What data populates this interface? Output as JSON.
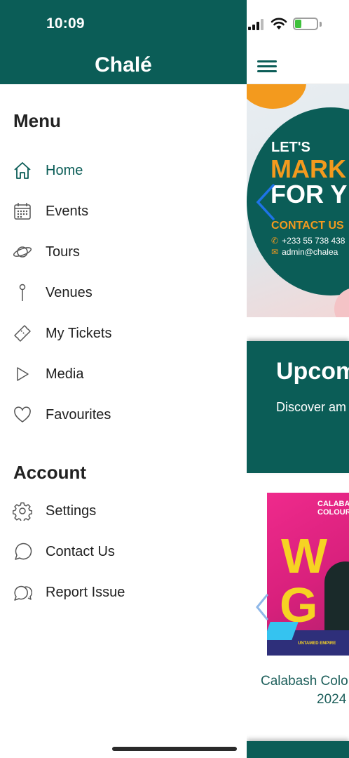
{
  "status_bar": {
    "time": "10:09",
    "battery_level": "27",
    "battery_percent": 0.27,
    "battery_color": "#3ec13b"
  },
  "drawer": {
    "app_title": "Chalé",
    "header_color": "#0b5d57",
    "menu_section_title": "Menu",
    "menu_items": [
      {
        "label": "Home",
        "icon": "home-icon",
        "active": true
      },
      {
        "label": "Events",
        "icon": "calendar-icon"
      },
      {
        "label": "Tours",
        "icon": "planet-icon"
      },
      {
        "label": "Venues",
        "icon": "pin-icon"
      },
      {
        "label": "My Tickets",
        "icon": "ticket-icon"
      },
      {
        "label": "Media",
        "icon": "play-icon"
      },
      {
        "label": "Favourites",
        "icon": "heart-icon"
      }
    ],
    "account_section_title": "Account",
    "account_items": [
      {
        "label": "Settings",
        "icon": "gear-icon"
      },
      {
        "label": "Contact Us",
        "icon": "chat-bubble-icon"
      },
      {
        "label": "Report Issue",
        "icon": "chat-bubbles-icon"
      }
    ]
  },
  "main": {
    "banner": {
      "lets": "LET'S",
      "market": "MARK",
      "for_you": "FOR Y",
      "contact": "CONTACT US",
      "phone": "+233 55 738 438",
      "email": "admin@chalea"
    },
    "upcoming": {
      "title": "Upcom",
      "subtitle": "Discover am"
    },
    "event": {
      "title": "Calabash Colo",
      "year": "2024",
      "poster_header": "CALABASH\nCOLOUR",
      "poster_text_1": "W",
      "poster_text_2": "G",
      "poster_footer": "UNTAMED EMPIRE"
    }
  }
}
